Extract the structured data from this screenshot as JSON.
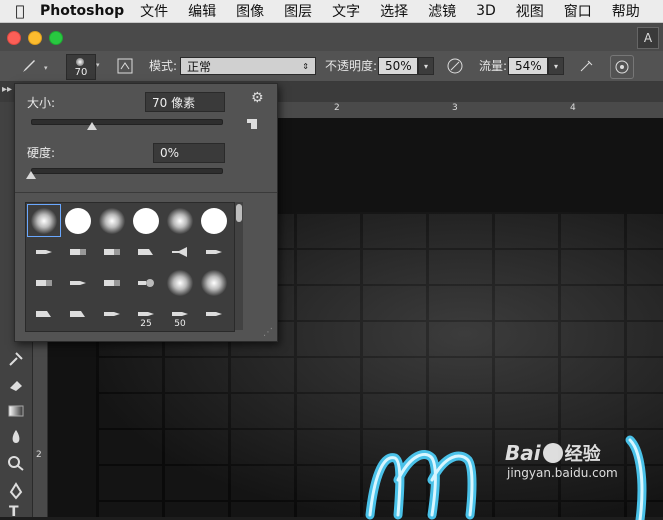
{
  "menubar": {
    "app": "Photoshop",
    "items": [
      "文件",
      "编辑",
      "图像",
      "图层",
      "文字",
      "选择",
      "滤镜",
      "3D",
      "视图",
      "窗口",
      "帮助"
    ]
  },
  "options_bar": {
    "brush_size": "70",
    "mode_label": "模式:",
    "mode_value": "正常",
    "opacity_label": "不透明度:",
    "opacity_value": "50%",
    "flow_label": "流量:",
    "flow_value": "54%"
  },
  "brush_panel": {
    "size_label": "大小:",
    "size_value": "70 像素",
    "size_fraction": 0.32,
    "hardness_label": "硬度:",
    "hardness_value": "0%",
    "hardness_fraction": 0.0,
    "presets": [
      {
        "shape": "soft-round"
      },
      {
        "shape": "hard-round"
      },
      {
        "shape": "soft-round"
      },
      {
        "shape": "hard-round"
      },
      {
        "shape": "soft-round"
      },
      {
        "shape": "hard-round"
      },
      {
        "shape": "pencil-tip"
      },
      {
        "shape": "flat-brush"
      },
      {
        "shape": "flat-brush"
      },
      {
        "shape": "angled-brush"
      },
      {
        "shape": "fan-brush"
      },
      {
        "shape": "pencil-tip"
      },
      {
        "shape": "flat-brush"
      },
      {
        "shape": "pencil-tip"
      },
      {
        "shape": "flat-brush"
      },
      {
        "shape": "round-bristle"
      },
      {
        "shape": "soft-round"
      },
      {
        "shape": "soft-round"
      },
      {
        "shape": "angled-brush"
      },
      {
        "shape": "angled-brush"
      },
      {
        "shape": "pencil-tip"
      },
      {
        "shape": "pencil-tip",
        "label": "25"
      },
      {
        "shape": "pencil-tip",
        "label": "50"
      },
      {
        "shape": "pencil-tip"
      }
    ]
  },
  "rulers": {
    "top_ticks": [
      "2",
      "3",
      "4"
    ],
    "left_ticks": [
      "2"
    ]
  },
  "watermark": {
    "brand": "Bai",
    "brand_suffix": "经验",
    "url": "jingyan.baidu.com"
  },
  "colors": {
    "accent": "#6aa8ff",
    "neon": "#4fd4ff"
  }
}
